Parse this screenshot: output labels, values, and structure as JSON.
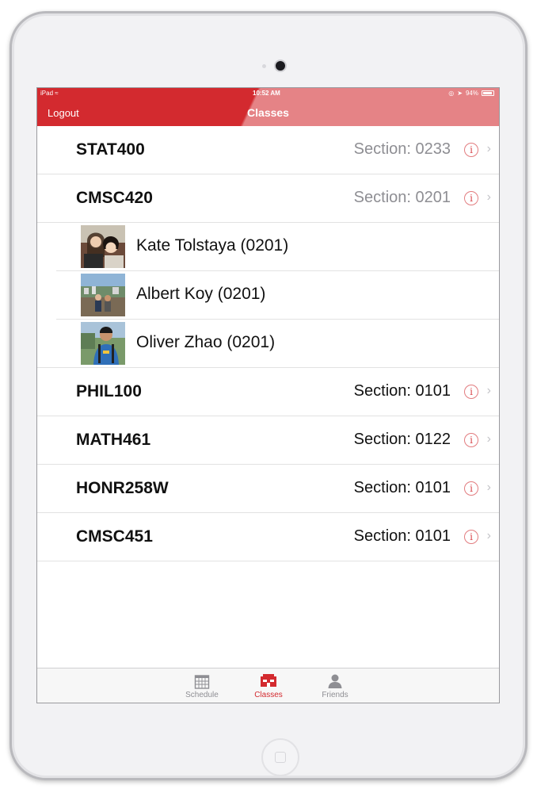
{
  "status_bar": {
    "carrier": "iPad",
    "time": "10:52 AM",
    "battery": "94%",
    "battery_fraction": 0.94
  },
  "nav": {
    "left_button": "Logout",
    "title": "Classes"
  },
  "rows": [
    {
      "kind": "class",
      "code": "STAT400",
      "section": "Section: 0233",
      "section_color": "#8e8e93"
    },
    {
      "kind": "class",
      "code": "CMSC420",
      "section": "Section: 0201",
      "section_color": "#8e8e93"
    },
    {
      "kind": "friend",
      "name": "Kate Tolstaya (0201)",
      "photo": "kate-photo"
    },
    {
      "kind": "friend",
      "name": "Albert Koy (0201)",
      "photo": "albert-photo"
    },
    {
      "kind": "friend",
      "name": "Oliver Zhao (0201)",
      "photo": "oliver-photo"
    },
    {
      "kind": "class",
      "code": "PHIL100",
      "section": "Section: 0101",
      "section_color": "#111111"
    },
    {
      "kind": "class",
      "code": "MATH461",
      "section": "Section: 0122",
      "section_color": "#111111"
    },
    {
      "kind": "class",
      "code": "HONR258W",
      "section": "Section: 0101",
      "section_color": "#111111"
    },
    {
      "kind": "class",
      "code": "CMSC451",
      "section": "Section: 0101",
      "section_color": "#111111"
    }
  ],
  "tabs": [
    {
      "label": "Schedule",
      "icon": "calendar-icon",
      "active": false
    },
    {
      "label": "Classes",
      "icon": "classes-icon",
      "active": true
    },
    {
      "label": "Friends",
      "icon": "person-icon",
      "active": false
    }
  ],
  "colors": {
    "brand_red": "#d32a2f",
    "inactive_tab": "#8e8e93"
  }
}
